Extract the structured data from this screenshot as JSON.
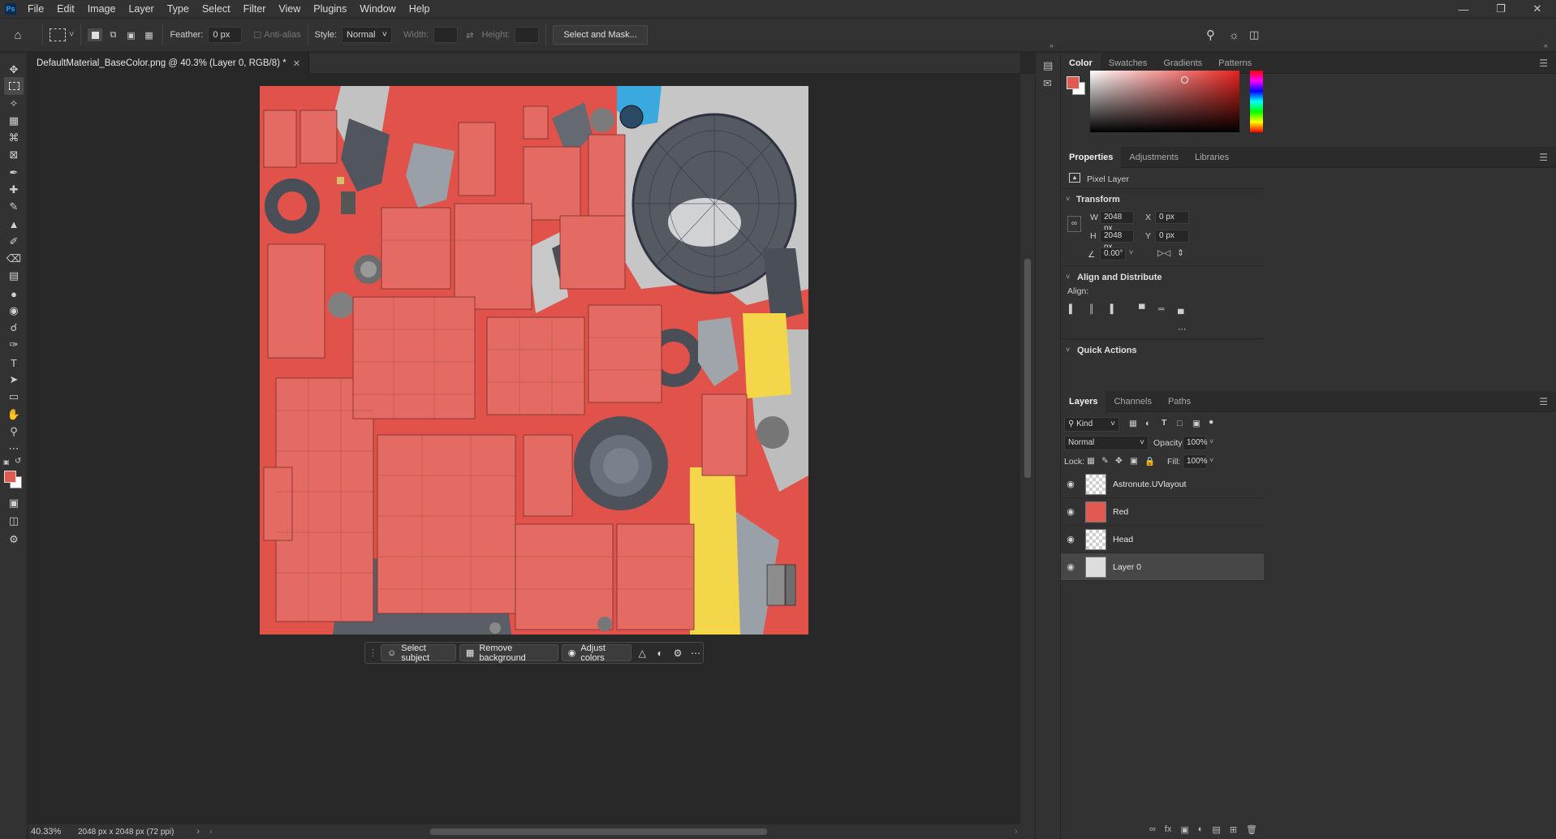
{
  "menubar": {
    "logo": "Ps",
    "items": [
      "File",
      "Edit",
      "Image",
      "Layer",
      "Type",
      "Select",
      "Filter",
      "View",
      "Plugins",
      "Window",
      "Help"
    ]
  },
  "options": {
    "feather_label": "Feather:",
    "feather_value": "0 px",
    "antialias_label": "Anti-alias",
    "style_label": "Style:",
    "style_value": "Normal",
    "width_label": "Width:",
    "height_label": "Height:",
    "select_mask_label": "Select and Mask..."
  },
  "document": {
    "tab_title": "DefaultMaterial_BaseColor.png @ 40.3% (Layer 0, RGB/8) *",
    "zoom": "40.33%",
    "dimensions": "2048 px x 2048 px (72 ppi)"
  },
  "taskbar": {
    "select_subject": "Select subject",
    "remove_background": "Remove background",
    "adjust_colors": "Adjust colors"
  },
  "color_panel": {
    "tabs": [
      "Color",
      "Swatches",
      "Gradients",
      "Patterns"
    ],
    "foreground": "#e05a52",
    "background": "#ffffff"
  },
  "properties_panel": {
    "tabs": [
      "Properties",
      "Adjustments",
      "Libraries"
    ],
    "layer_type": "Pixel Layer",
    "transform_label": "Transform",
    "w_label": "W",
    "w_value": "2048 px",
    "h_label": "H",
    "h_value": "2048 px",
    "x_label": "X",
    "x_value": "0 px",
    "y_label": "Y",
    "y_value": "0 px",
    "angle_value": "0.00°",
    "align_distribute_label": "Align and Distribute",
    "align_label": "Align:",
    "quick_actions_label": "Quick Actions"
  },
  "layers_panel": {
    "tabs": [
      "Layers",
      "Channels",
      "Paths"
    ],
    "filter_kind": "Kind",
    "blend_mode": "Normal",
    "opacity_label": "Opacity:",
    "opacity_value": "100%",
    "lock_label": "Lock:",
    "fill_label": "Fill:",
    "fill_value": "100%",
    "layers": [
      {
        "name": "Astronute.UVlayout"
      },
      {
        "name": "Red"
      },
      {
        "name": "Head"
      },
      {
        "name": "Layer 0"
      }
    ]
  }
}
